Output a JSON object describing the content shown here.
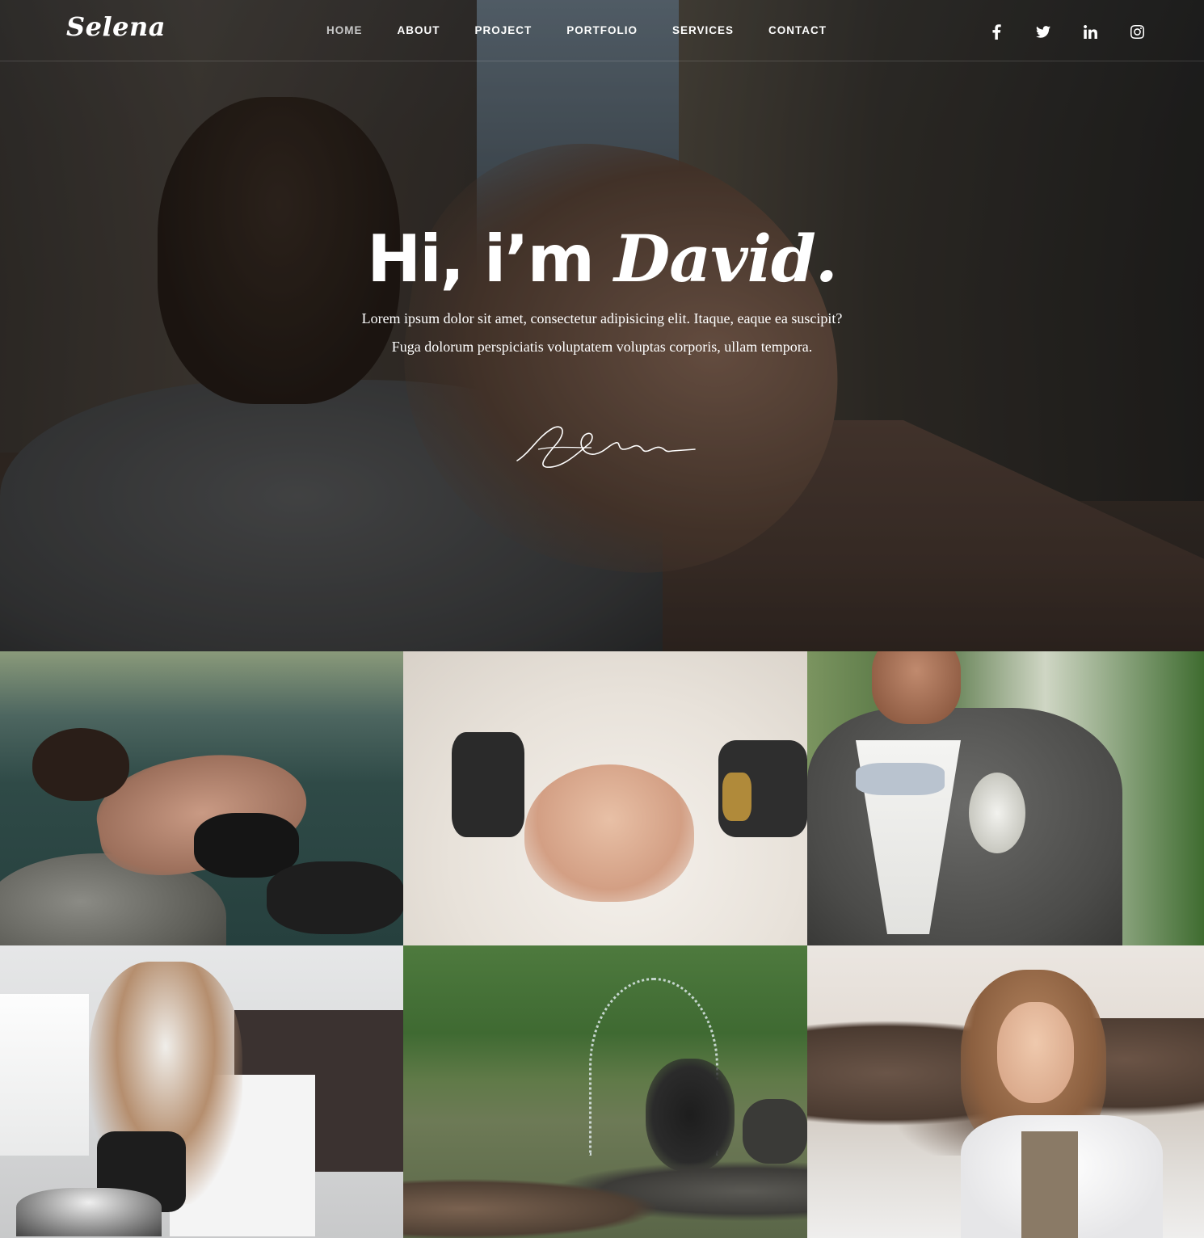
{
  "header": {
    "logo": "Selena",
    "nav": [
      {
        "label": "HOME",
        "active": true
      },
      {
        "label": "ABOUT",
        "active": false
      },
      {
        "label": "PROJECT",
        "active": false
      },
      {
        "label": "PORTFOLIO",
        "active": false
      },
      {
        "label": "SERVICES",
        "active": false
      },
      {
        "label": "CONTACT",
        "active": false
      }
    ],
    "social": [
      "facebook-icon",
      "twitter-icon",
      "linkedin-icon",
      "instagram-icon"
    ]
  },
  "hero": {
    "greeting": "Hi, i’m ",
    "name": "David.",
    "text": "Lorem ipsum dolor sit amet, consectetur adipisicing elit. Itaque, eaque ea suscipit? Fuga dolorum perspiciatis voluptatem voluptas corporis, ullam tempora.",
    "background": "photographer-street-photo"
  },
  "gallery": {
    "items": [
      {
        "subject": "woman-lying-on-rock-by-water"
      },
      {
        "subject": "wedding-couple-heart-hands"
      },
      {
        "subject": "groom-with-bow-tie"
      },
      {
        "subject": "woman-in-kitchen"
      },
      {
        "subject": "woman-splashing-water"
      },
      {
        "subject": "woman-on-rocky-beach"
      }
    ]
  },
  "colors": {
    "nav_active": "#c8c8c8",
    "nav_text": "#ffffff",
    "hero_text": "#ffffff"
  }
}
